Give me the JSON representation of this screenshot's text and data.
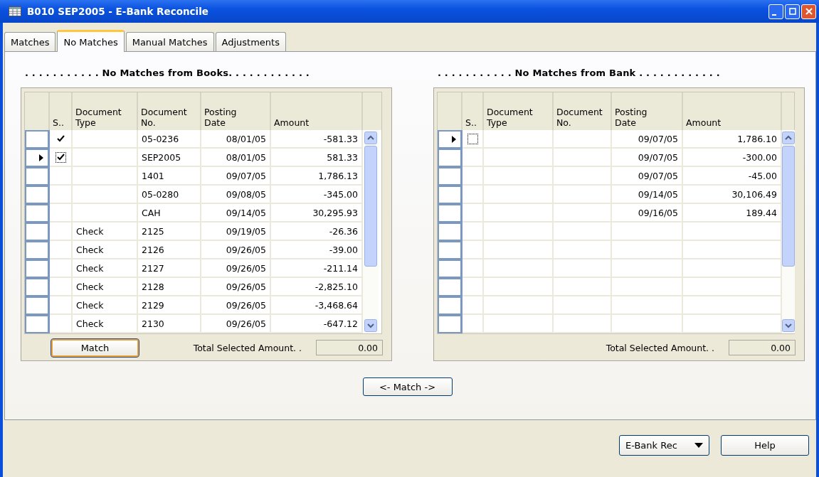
{
  "window": {
    "title": "B010 SEP2005 - E-Bank Reconcile"
  },
  "tabs": [
    {
      "label": "Matches",
      "selected": false
    },
    {
      "label": "No Matches",
      "selected": true
    },
    {
      "label": "Manual Matches",
      "selected": false
    },
    {
      "label": "Adjustments",
      "selected": false
    }
  ],
  "panels": [
    {
      "heading": ". . . . . . . . . . . No Matches from Books. . . . . . . . . . . .",
      "columns": [
        "S..",
        "Document Type",
        "Document No.",
        "Posting Date",
        "Amount"
      ],
      "rows": [
        {
          "current": false,
          "checked": true,
          "document_type": "",
          "document_no": "05-0236",
          "posting_date": "08/01/05",
          "amount": "-581.33"
        },
        {
          "current": true,
          "checked": true,
          "document_type": "",
          "document_no": "SEP2005",
          "posting_date": "08/01/05",
          "amount": "581.33"
        },
        {
          "current": false,
          "checked": false,
          "document_type": "",
          "document_no": "1401",
          "posting_date": "09/07/05",
          "amount": "1,786.13"
        },
        {
          "current": false,
          "checked": false,
          "document_type": "",
          "document_no": "05-0280",
          "posting_date": "09/08/05",
          "amount": "-345.00"
        },
        {
          "current": false,
          "checked": false,
          "document_type": "",
          "document_no": "CAH",
          "posting_date": "09/14/05",
          "amount": "30,295.93"
        },
        {
          "current": false,
          "checked": false,
          "document_type": "Check",
          "document_no": "2125",
          "posting_date": "09/19/05",
          "amount": "-26.36"
        },
        {
          "current": false,
          "checked": false,
          "document_type": "Check",
          "document_no": "2126",
          "posting_date": "09/26/05",
          "amount": "-39.00"
        },
        {
          "current": false,
          "checked": false,
          "document_type": "Check",
          "document_no": "2127",
          "posting_date": "09/26/05",
          "amount": "-211.14"
        },
        {
          "current": false,
          "checked": false,
          "document_type": "Check",
          "document_no": "2128",
          "posting_date": "09/26/05",
          "amount": "-2,825.10"
        },
        {
          "current": false,
          "checked": false,
          "document_type": "Check",
          "document_no": "2129",
          "posting_date": "09/26/05",
          "amount": "-3,468.64"
        },
        {
          "current": false,
          "checked": false,
          "document_type": "Check",
          "document_no": "2130",
          "posting_date": "09/26/05",
          "amount": "-647.12"
        }
      ],
      "match_button": "Match",
      "total_label": "Total Selected Amount. .",
      "total_value": "0.00"
    },
    {
      "heading": ". . . . . . . . . . . No Matches from Bank . . . . . . . . . . . .",
      "columns": [
        "S..",
        "Document Type",
        "Document No.",
        "Posting Date",
        "Amount"
      ],
      "rows": [
        {
          "current": true,
          "checked": false,
          "document_type": "",
          "document_no": "",
          "posting_date": "09/07/05",
          "amount": "1,786.10"
        },
        {
          "current": false,
          "checked": false,
          "document_type": "",
          "document_no": "",
          "posting_date": "09/07/05",
          "amount": "-300.00"
        },
        {
          "current": false,
          "checked": false,
          "document_type": "",
          "document_no": "",
          "posting_date": "09/07/05",
          "amount": "-45.00"
        },
        {
          "current": false,
          "checked": false,
          "document_type": "",
          "document_no": "",
          "posting_date": "09/14/05",
          "amount": "30,106.49"
        },
        {
          "current": false,
          "checked": false,
          "document_type": "",
          "document_no": "",
          "posting_date": "09/16/05",
          "amount": "189.44"
        }
      ],
      "total_label": "Total Selected Amount. .",
      "total_value": "0.00"
    }
  ],
  "center_button": "<- Match ->",
  "footer": {
    "dropdown": "E-Bank Rec",
    "help_button": "Help"
  }
}
